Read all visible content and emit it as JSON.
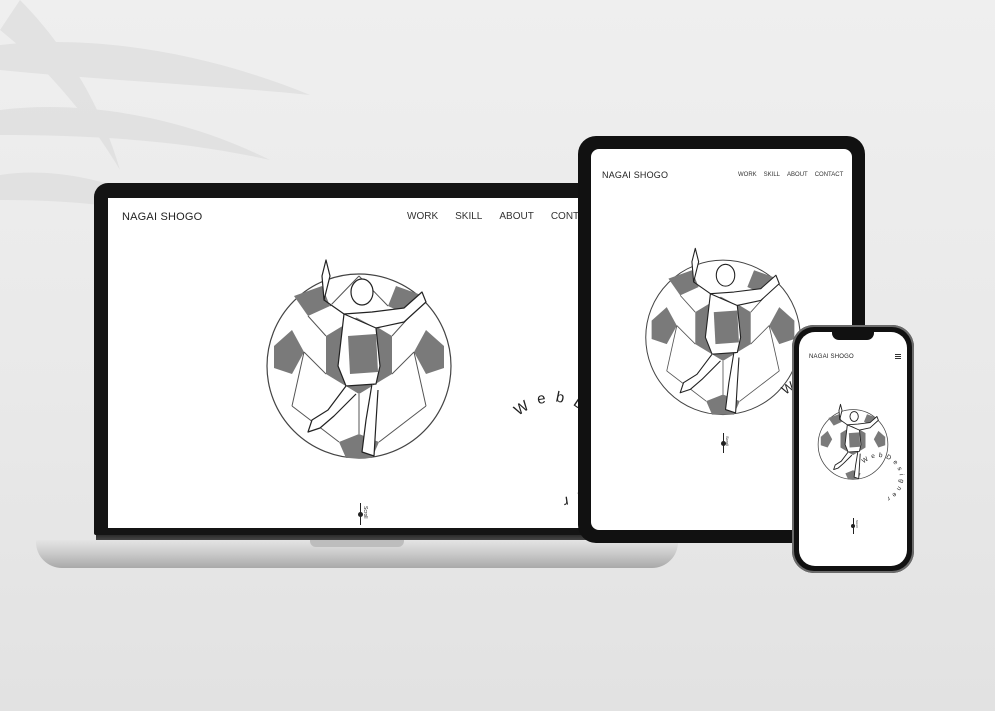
{
  "brand": "NAGAI SHOGO",
  "nav": [
    "WORK",
    "SKILL",
    "ABOUT",
    "CONTACT"
  ],
  "tagline": "WebDesigner",
  "scroll_label": "Scroll",
  "icons": {
    "menu": "hamburger-menu-icon",
    "hero": "soccer-player-illustration",
    "scroll": "scroll-indicator-icon"
  },
  "colors": {
    "accent_gray": "#7a7a7a",
    "text": "#222222",
    "screen_bg": "#ffffff",
    "device_frame": "#141414",
    "backdrop": "#ececec"
  }
}
